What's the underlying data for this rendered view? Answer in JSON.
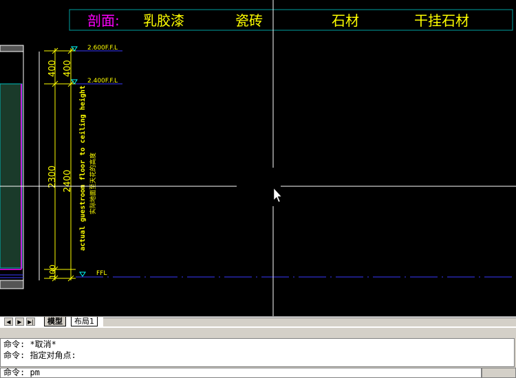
{
  "legend": {
    "label": "剖面:",
    "items": [
      "乳胶漆",
      "瓷砖",
      "石材",
      "干挂石材"
    ]
  },
  "drawing": {
    "level_top": "2.600F.F.L",
    "level_mid": "2.400F.F.L",
    "level_floor": "FFL",
    "dim_400_a": "400",
    "dim_400_b": "400",
    "dim_2300": "2300",
    "dim_2400": "2400",
    "dim_100": "100",
    "note_en": "actual guestroom floor to ceiling height",
    "note_cn": "实际地面至天花的高度"
  },
  "tabs": {
    "nav": [
      "◀",
      "▶",
      "▶|"
    ],
    "model": "模型",
    "layout1": "布局1"
  },
  "command": {
    "history": [
      "命令: *取消*",
      "命令: 指定对角点:"
    ],
    "input": "命令: pm"
  },
  "colors": {
    "canvas": "#000000",
    "magenta": "#ff00ff",
    "yellow": "#ffff00",
    "cyan": "#00ffff",
    "blue": "#3a3aff",
    "white": "#ffffff"
  }
}
